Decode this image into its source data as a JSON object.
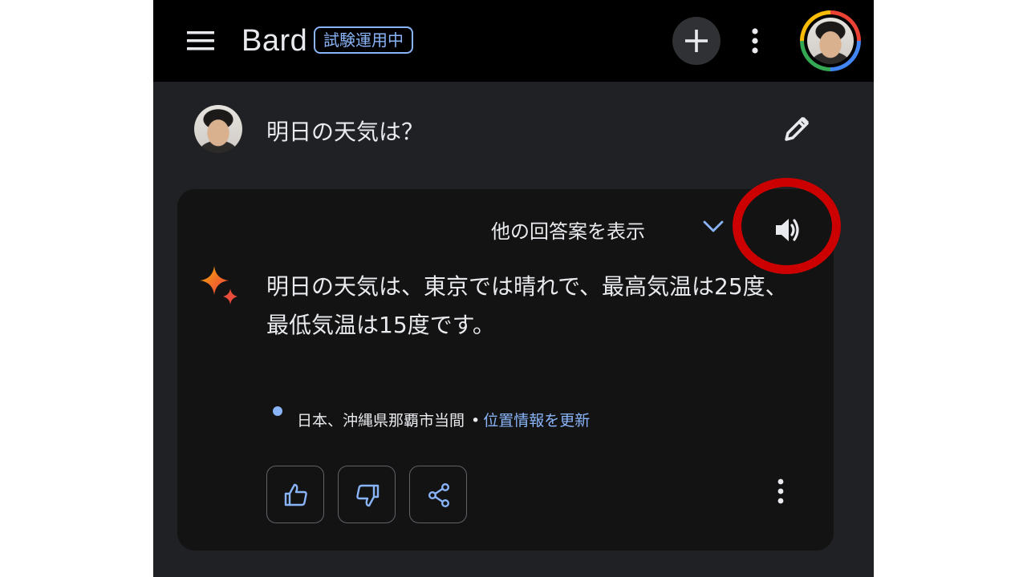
{
  "app": {
    "title": "Bard",
    "badge": "試験運用中"
  },
  "header": {
    "menu_icon": "hamburger-menu-icon",
    "new_chat_icon": "plus-icon",
    "more_icon": "vertical-dots-icon",
    "avatar_ring_colors": [
      "#ea4335",
      "#4285f4",
      "#34a853",
      "#fbbc05"
    ]
  },
  "conversation": {
    "user_prompt": "明日の天気は？",
    "edit_icon": "pencil-icon",
    "response": {
      "view_drafts_label": "他の回答案を表示",
      "text_line1": "明日の天気は、東京では晴れで、最高気温は25度、",
      "text_line2": "最低気温は15度です。",
      "location": "日本、沖縄県那覇市当間",
      "location_separator": "•",
      "update_location_link": "位置情報を更新",
      "highlight_color": "#cc0000"
    }
  },
  "colors": {
    "background": "#202124",
    "appbar": "#000000",
    "card": "#131314",
    "text": "#e8eaed",
    "accent": "#8ab4f8"
  }
}
